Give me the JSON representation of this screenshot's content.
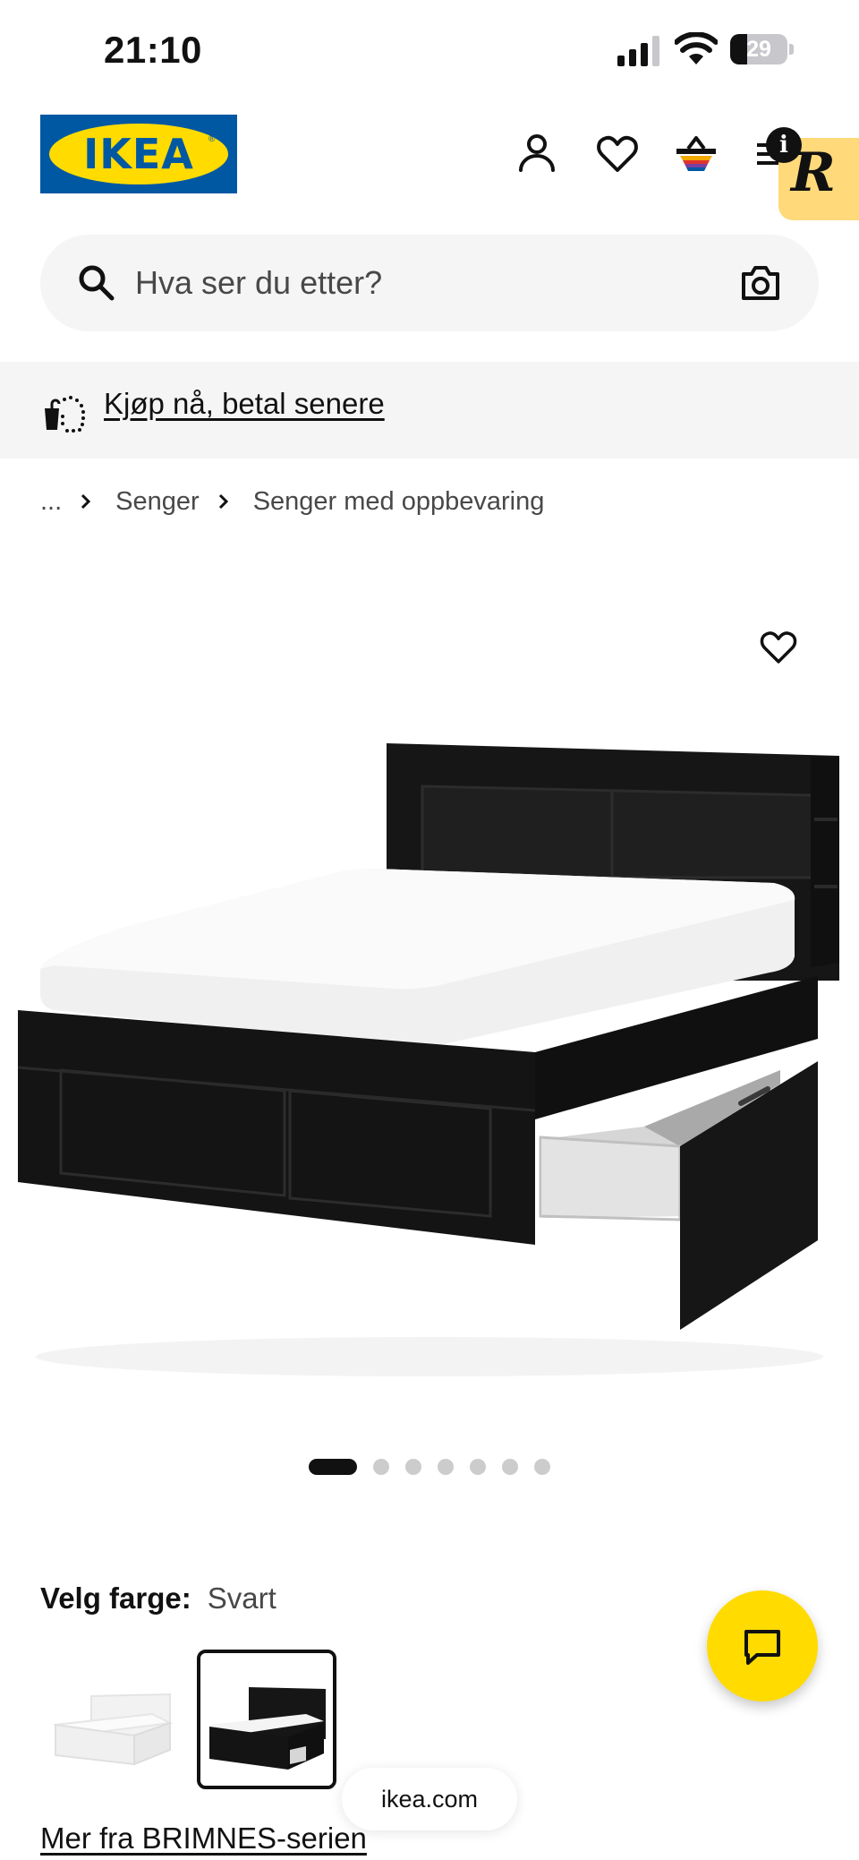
{
  "status_bar": {
    "time": "21:10",
    "battery_level": "29",
    "icons": [
      "cellular-signal-icon",
      "wifi-icon",
      "battery-icon"
    ]
  },
  "header": {
    "logo_text": "IKEA",
    "icons": [
      "profile-icon",
      "heart-icon",
      "shopping-bag-icon",
      "menu-icon"
    ],
    "info_badge": "i",
    "extension_badge": "R"
  },
  "search": {
    "placeholder": "Hva ser du etter?",
    "icons": [
      "search-icon",
      "camera-icon"
    ]
  },
  "promo": {
    "label": "Kjøp nå, betal senere",
    "icon": "bag-dotted-icon"
  },
  "breadcrumb": {
    "ellipsis": "...",
    "items": [
      "Senger",
      "Senger med oppbevaring"
    ]
  },
  "gallery": {
    "image_count": 7,
    "active_index": 0,
    "subject": "black bed frame with storage drawers and headboard"
  },
  "color_selector": {
    "label": "Velg farge:",
    "value": "Svart",
    "options": [
      "white",
      "black"
    ],
    "selected": "black"
  },
  "series_link": "Mer fra BRIMNES-serien",
  "browser": {
    "url": "ikea.com"
  },
  "colors": {
    "ikea_blue": "#0058a3",
    "ikea_yellow": "#ffdb00",
    "text_primary": "#111111",
    "text_secondary": "#484848",
    "surface": "#f5f5f5"
  }
}
